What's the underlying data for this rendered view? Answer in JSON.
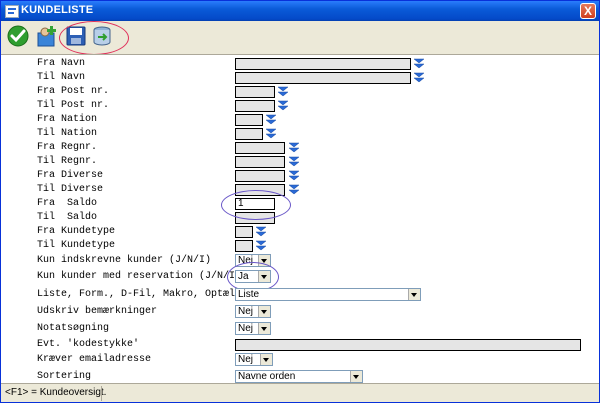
{
  "window": {
    "title": "KUNDELISTE",
    "close_label": "X"
  },
  "toolbar": {
    "buttons": [
      "ok-icon",
      "add-user-icon",
      "save-icon",
      "database-export-icon"
    ]
  },
  "form": {
    "fra_navn": "Fra Navn",
    "til_navn": "Til Navn",
    "fra_postnr": "Fra Post nr.",
    "til_postnr": "Til Post nr.",
    "fra_nation": "Fra Nation",
    "til_nation": "Til Nation",
    "fra_regnr": "Fra Regnr.",
    "til_regnr": "Til Regnr.",
    "fra_diverse": "Fra Diverse",
    "til_diverse": "Til Diverse",
    "fra_saldo": "Fra  Saldo",
    "fra_saldo_value": "1",
    "til_saldo": "Til  Saldo",
    "fra_kundetype": "Fra Kundetype",
    "til_kundetype": "Til Kundetype",
    "kun_indskrevne": "Kun indskrevne kunder (J/N/I)",
    "kun_indskrevne_value": "Nej",
    "kun_reservation": "Kun kunder med reservation (J/N/I)",
    "kun_reservation_value": "Ja",
    "liste": "Liste, Form., D-Fil, Makro, Optæl.",
    "liste_value": "Liste",
    "udskriv": "Udskriv bemærkninger",
    "udskriv_value": "Nej",
    "notatsogning": "Notatsøgning",
    "notatsogning_value": "Nej",
    "kodestykke": "Evt. 'kodestykke'",
    "kraever_email": "Kræver emailadresse",
    "kraever_email_value": "Nej",
    "sortering": "Sortering",
    "sortering_value": "Navne orden"
  },
  "status": {
    "text": "<F1> = Kundeoversigt."
  },
  "colors": {
    "title_bar": "#0a5bd8",
    "field_bg": "#e5e5e5",
    "icon_blue": "#2a6ad6"
  }
}
